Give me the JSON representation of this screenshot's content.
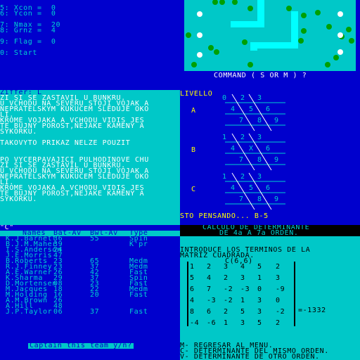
{
  "settings": [
    {
      "label": "5: Xcon =",
      "value": "0"
    },
    {
      "label": "6: Ycon =",
      "value": "0"
    },
    {
      "label": "7: Nmax =",
      "value": "20"
    },
    {
      "label": "8: Grnz =",
      "value": "4"
    },
    {
      "label": "9: Flag =",
      "value": "0"
    },
    {
      "label": "0: Start",
      "value": ""
    }
  ],
  "map": {
    "prompt": "COMMAND ( S OR M ) ?",
    "colors": {
      "field": "#00c8c8",
      "snake": "#00ffff",
      "tree": "#00a000",
      "figure": "#ffffff"
    }
  },
  "text_adventure": {
    "lines": [
      "Ziffer: L",
      "ZI SI SE ZASTAVIL U BUNKRU.",
      "U VCHODU NA SEVERU STOJI VOJAK A",
      "NEPRATELSKYM KUKUCEM SLEDUJE OKO",
      "LI.",
      "KROME VOJAKA A VCHODU VIDIS JES",
      "TE BUJNY POROST,NEJAKE KAMENY A",
      "SYKORKU.",
      "",
      "TAKOVYTO PRIKAZ NELZE POUZIT",
      "",
      "",
      "PO VYCERPAVAJICI PULHODINOVE CHU",
      "ZI SI SE ZASTAVIL U BUNKRU.",
      "U VCHODU NA SEVERU STOJI VOJAK A",
      "NEPRATELSKYM KUKUCEM SLEDUJE OKO",
      "LI.",
      "KROME VOJAKA A VCHODU VIDIS JES",
      "TE BUJNY POROST,NEJAKE KAMENY A",
      "SYKORKU."
    ]
  },
  "livello": {
    "title": "LIVELLO",
    "boards": [
      {
        "label": "A",
        "rows": [
          [
            "0",
            "2",
            "3"
          ],
          [
            "4",
            "5",
            "6"
          ],
          [
            "7",
            "8",
            "9"
          ]
        ]
      },
      {
        "label": "B",
        "rows": [
          [
            "1",
            "2",
            "3"
          ],
          [
            "4",
            "X",
            "6"
          ],
          [
            "7",
            "8",
            "9"
          ]
        ]
      },
      {
        "label": "C",
        "rows": [
          [
            "1",
            "2",
            "3"
          ],
          [
            "4",
            "5",
            "6"
          ],
          [
            "7",
            "8",
            "9"
          ]
        ]
      }
    ],
    "status": "STO PENSANDO... B-5"
  },
  "team": {
    "header_key": "\"C\"",
    "columns": [
      "Names",
      "Bat-Av",
      "Bwl-Av",
      "Type"
    ],
    "rows": [
      [
        "K.J.Barnett",
        "36",
        "55",
        "Spin"
      ],
      [
        "B.J.M.Maher",
        "39",
        "",
        "K'pr"
      ],
      [
        "I.S.Anderson",
        "24",
        "",
        ""
      ],
      [
        "J.E.Morris",
        "47",
        "",
        ""
      ],
      [
        "B.Roberts",
        "23",
        "65",
        "Medm"
      ],
      [
        "R.J.Finney",
        "23",
        "37",
        "Medm"
      ],
      [
        "A.E.Warner",
        "26",
        "42",
        "Fast"
      ],
      [
        "K.Sharma",
        "29",
        "37",
        "Spin"
      ],
      [
        "D.Mortensen",
        "08",
        "23",
        "Fast"
      ],
      [
        "M.Jacques",
        "18",
        "22",
        "Medm"
      ],
      [
        "M.Holding",
        "16",
        "20",
        "Fast"
      ],
      [
        "A.M.Brown",
        "26",
        "",
        ""
      ],
      [
        "A.Hill",
        "48",
        "",
        ""
      ],
      [
        "J.P.Taylor",
        "06",
        "37",
        "Fast"
      ]
    ],
    "prompt": "Captain this team y/n?"
  },
  "determinant": {
    "title1": "CALCULO DE DETERMINANTE",
    "title2": "DE 4a A 7a ORDEN.",
    "intro1": "INTRODUCE LOS TERMINOS DE LA",
    "intro2": "MATRIZ CUADRADA.",
    "size": "C(6,6)",
    "matrix": [
      [
        "1",
        "2",
        "3",
        "4",
        "5",
        "2"
      ],
      [
        "5",
        "4",
        "2",
        "3",
        "1",
        "3"
      ],
      [
        "6",
        "7",
        "-2",
        "-3",
        "0",
        "-9"
      ],
      [
        "4",
        "-3",
        "-2",
        "1",
        "3",
        "0"
      ],
      [
        "8",
        "6",
        "2",
        "5",
        "3",
        "-2"
      ],
      [
        "-4",
        "-6",
        "1",
        "3",
        "5",
        "2"
      ]
    ],
    "result": "=-1332",
    "menu": [
      "M- REGRESAR AL MENU.",
      "C- DETERMINANTE DEL MISMO ORDEN.",
      "V- DETERMINANTE DE OTRO ORDEN."
    ]
  }
}
